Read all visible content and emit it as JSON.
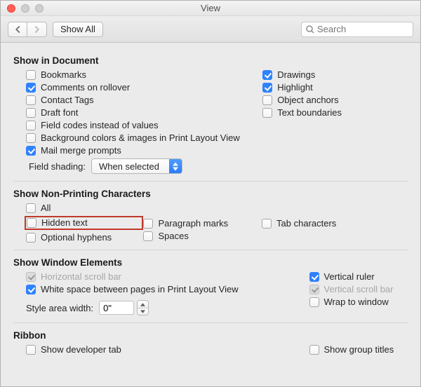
{
  "window": {
    "title": "View"
  },
  "toolbar": {
    "showAll": "Show All",
    "searchPlaceholder": "Search"
  },
  "sections": {
    "showInDocument": {
      "title": "Show in Document",
      "left": {
        "bookmarks": {
          "label": "Bookmarks",
          "checked": false
        },
        "commentsRollover": {
          "label": "Comments on rollover",
          "checked": true
        },
        "contactTags": {
          "label": "Contact Tags",
          "checked": false
        },
        "draftFont": {
          "label": "Draft font",
          "checked": false
        },
        "fieldCodes": {
          "label": "Field codes instead of values",
          "checked": false
        },
        "bgColors": {
          "label": "Background colors & images in Print Layout View",
          "checked": false
        },
        "mailMerge": {
          "label": "Mail merge prompts",
          "checked": true
        }
      },
      "right": {
        "drawings": {
          "label": "Drawings",
          "checked": true
        },
        "highlight": {
          "label": "Highlight",
          "checked": true
        },
        "objectAnchors": {
          "label": "Object anchors",
          "checked": false
        },
        "textBoundaries": {
          "label": "Text boundaries",
          "checked": false
        }
      },
      "fieldShading": {
        "label": "Field shading:",
        "value": "When selected"
      }
    },
    "nonPrinting": {
      "title": "Show Non-Printing Characters",
      "all": {
        "label": "All",
        "checked": false
      },
      "hiddenText": {
        "label": "Hidden text",
        "checked": false
      },
      "optionalHyphens": {
        "label": "Optional hyphens",
        "checked": false
      },
      "paragraphMarks": {
        "label": "Paragraph marks",
        "checked": false
      },
      "spaces": {
        "label": "Spaces",
        "checked": false
      },
      "tabCharacters": {
        "label": "Tab characters",
        "checked": false
      }
    },
    "windowElements": {
      "title": "Show Window Elements",
      "horizontalScroll": {
        "label": "Horizontal scroll bar",
        "checked": true,
        "disabled": true
      },
      "whiteSpace": {
        "label": "White space between pages in Print Layout View",
        "checked": true
      },
      "verticalRuler": {
        "label": "Vertical ruler",
        "checked": true
      },
      "verticalScroll": {
        "label": "Vertical scroll bar",
        "checked": true,
        "disabled": true
      },
      "wrapToWindow": {
        "label": "Wrap to window",
        "checked": false
      },
      "styleAreaWidth": {
        "label": "Style area width:",
        "value": "0\""
      }
    },
    "ribbon": {
      "title": "Ribbon",
      "developerTab": {
        "label": "Show developer tab",
        "checked": false
      },
      "groupTitles": {
        "label": "Show group titles",
        "checked": false
      }
    }
  }
}
